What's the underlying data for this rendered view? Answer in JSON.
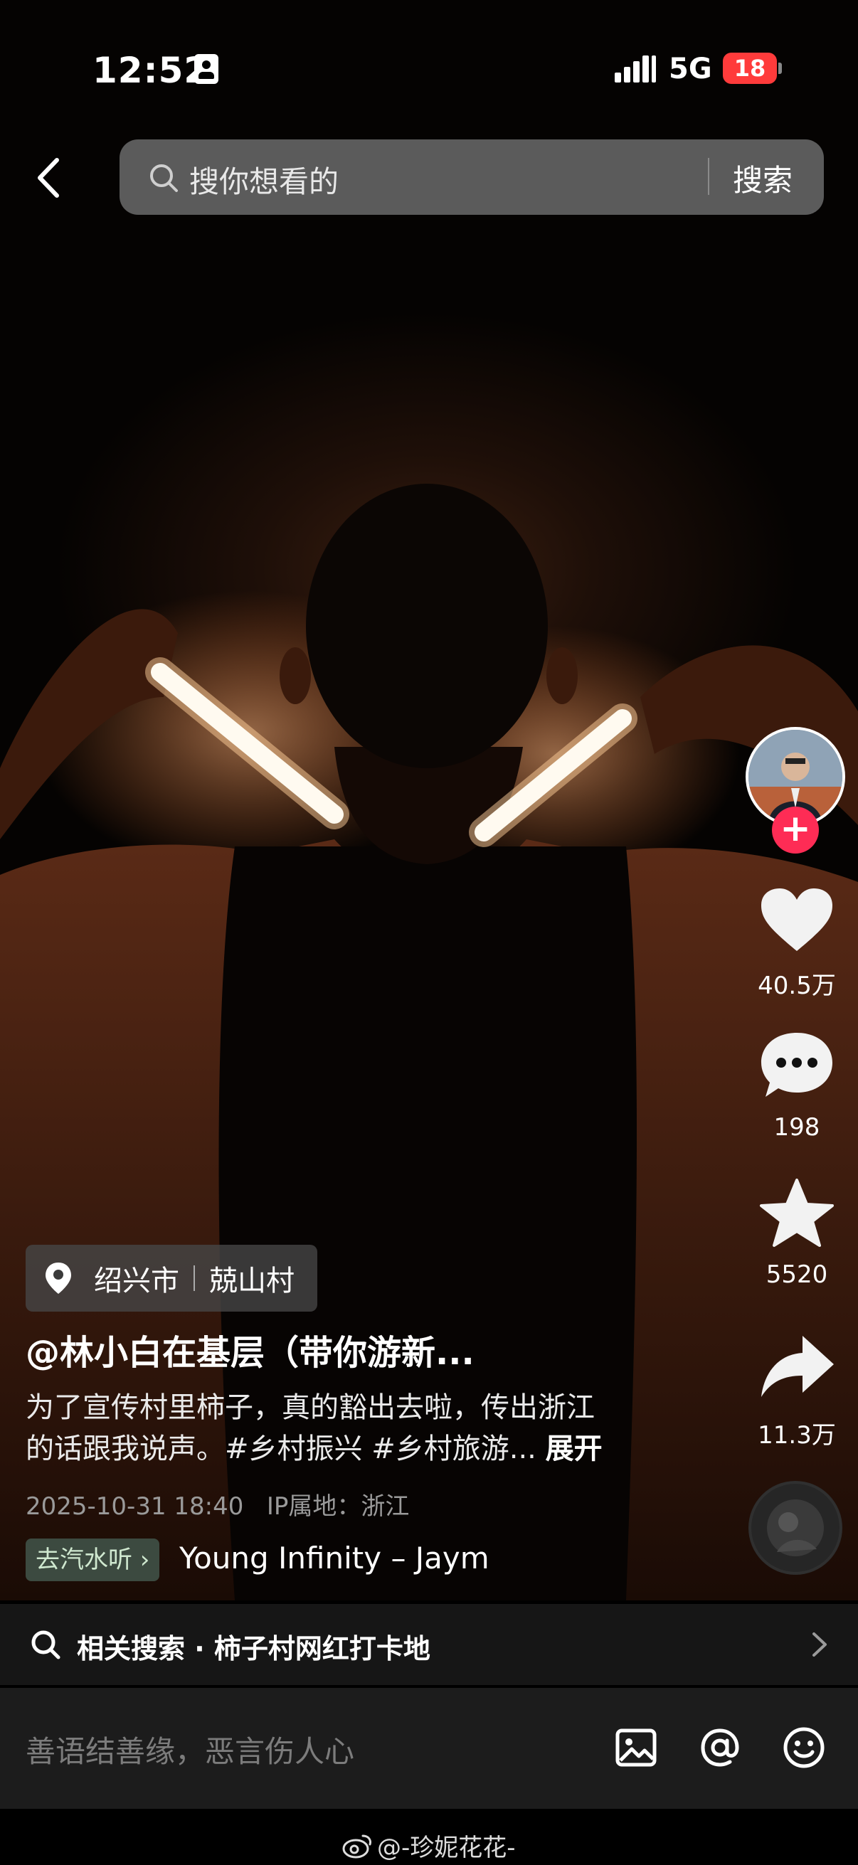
{
  "status_bar": {
    "time": "12:52",
    "network": "5G",
    "battery": "18"
  },
  "search": {
    "placeholder": "搜你想看的",
    "button_label": "搜索"
  },
  "actions": {
    "likes": "40.5万",
    "comments": "198",
    "favorites": "5520",
    "shares": "11.3万"
  },
  "post": {
    "location_city": "绍兴市",
    "location_village": "兢山村",
    "author": "@林小白在基层（带你游新...",
    "description_line1": "为了宣传村里柿子，真的豁出去啦，传出浙江",
    "description_line2": "的话跟我说声。#乡村振兴 #乡村旅游...",
    "expand_label": "展开",
    "datetime": "2025-10-31 18:40",
    "ip_location": "IP属地：浙江",
    "music_tag": "去汽水听 ›",
    "music_name": "Young    Infinity – Jaym"
  },
  "related_search": {
    "text": "相关搜索 · 柿子村网红打卡地"
  },
  "comment_bar": {
    "placeholder": "善语结善缘，恶言伤人心"
  },
  "watermark": {
    "text": "@-珍妮花花-"
  },
  "colors": {
    "accent": "#fe2c55",
    "battery_low": "#ff3b3b",
    "background": "#000000"
  },
  "icons": [
    "id-card-icon",
    "signal-icon",
    "back-icon",
    "search-icon",
    "heart-icon",
    "comment-icon",
    "star-icon",
    "share-icon",
    "location-pin-icon",
    "image-icon",
    "at-icon",
    "emoji-icon",
    "chevron-right-icon",
    "weibo-icon"
  ]
}
